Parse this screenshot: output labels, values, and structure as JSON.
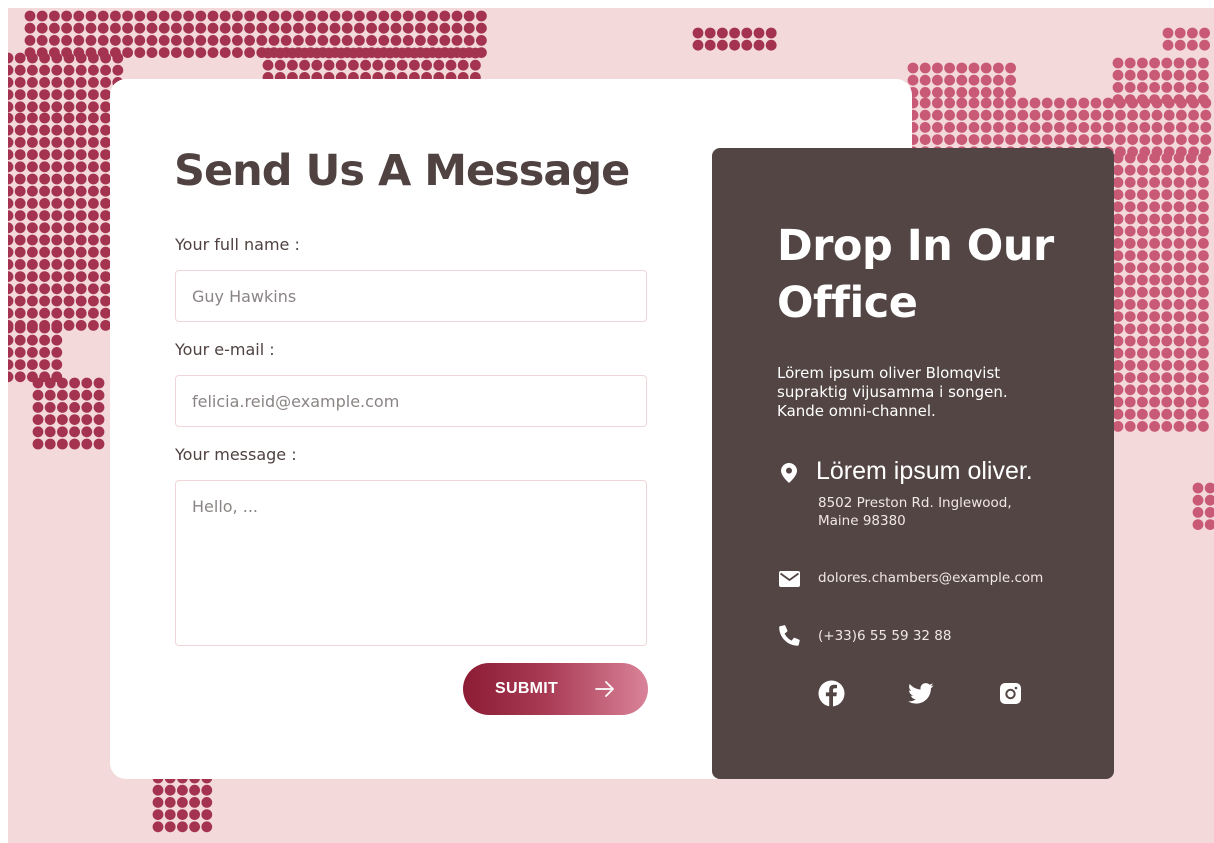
{
  "form": {
    "title": "Send Us A Message",
    "name_label": "Your full name :",
    "name_placeholder": "Guy Hawkins",
    "email_label": "Your e-mail :",
    "email_placeholder": "felicia.reid@example.com",
    "message_label": "Your message :",
    "message_placeholder": "Hello, ...",
    "submit_label": "SUBMIT"
  },
  "office": {
    "title": "Drop In Our Office",
    "description": "Lörem ipsum oliver Blomqvist supraktig vijusamma i songen. Kande omni-channel.",
    "location_heading": "Lörem ipsum oliver.",
    "address": "8502 Preston Rd. Inglewood, Maine 98380",
    "email": "dolores.chambers@example.com",
    "phone": "(+33)6 55 59 32 88"
  },
  "icons": {
    "location": "map-pin-icon",
    "email": "envelope-icon",
    "phone": "phone-icon",
    "social": [
      "facebook-icon",
      "twitter-icon",
      "instagram-icon"
    ],
    "submit": "arrow-right-icon"
  },
  "colors": {
    "background": "#f3d9da",
    "dots_dark": "#a3334f",
    "dots_light": "#c95a76",
    "panel": "#524544",
    "title": "#4f4241",
    "button_start": "#8c1c34",
    "button_end": "#d98398"
  }
}
